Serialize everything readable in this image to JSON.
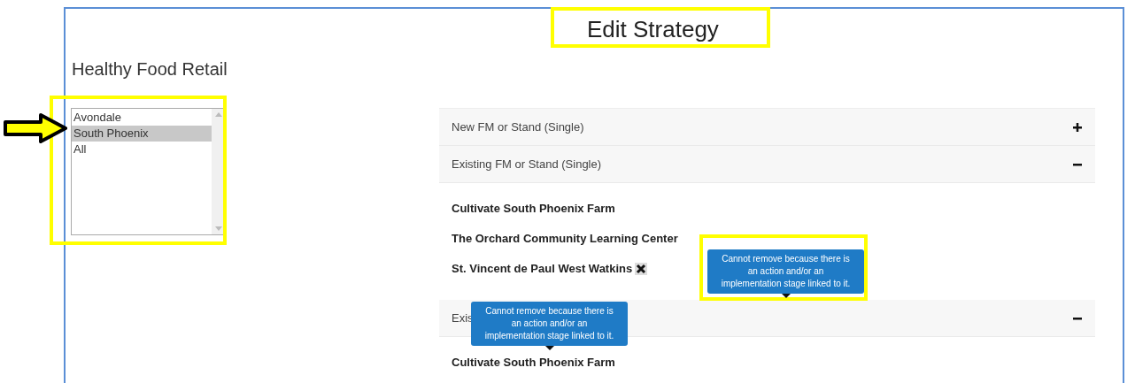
{
  "title": "Edit Strategy",
  "strategy": "Healthy Food Retail",
  "locations": [
    {
      "label": "Avondale",
      "selected": false
    },
    {
      "label": "South Phoenix",
      "selected": true
    },
    {
      "label": "All",
      "selected": false
    }
  ],
  "sections": [
    {
      "label": "New FM or Stand (Single)",
      "expanded": false
    },
    {
      "label": "Existing FM or Stand (Single)",
      "expanded": true,
      "items": [
        {
          "label": "Cultivate South Phoenix Farm",
          "removable": false
        },
        {
          "label": "The Orchard Community Learning Center",
          "removable": false
        },
        {
          "label": "St. Vincent de Paul West Watkins",
          "removable": true
        }
      ]
    },
    {
      "label": "Exis",
      "expanded": true,
      "items": [
        {
          "label": "Cultivate South Phoenix Farm",
          "removable": false
        }
      ]
    }
  ],
  "tooltips": [
    "Cannot remove because there is an action and/or an implementation stage linked to it.",
    "Cannot remove because there is an action and/or an implementation stage linked to it."
  ]
}
